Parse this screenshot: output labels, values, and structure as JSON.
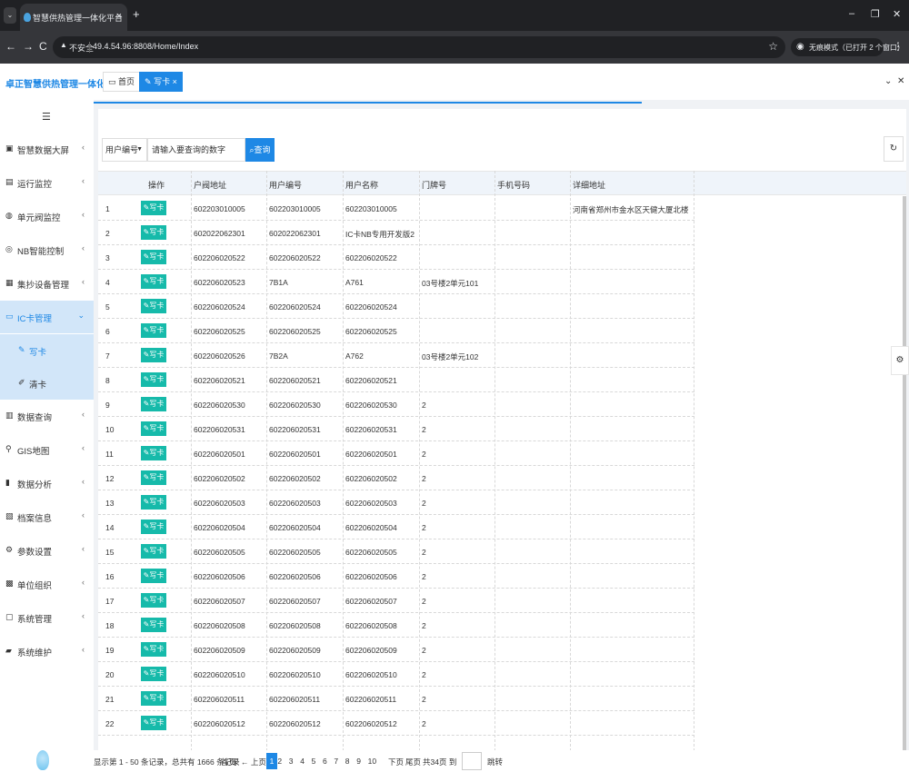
{
  "browser": {
    "tab_title": "智慧供热管理一体化平台",
    "tab_close": "×",
    "new_tab": "+",
    "minimize": "–",
    "maximize": "❐",
    "close": "✕",
    "back": "←",
    "forward": "→",
    "reload": "C",
    "insecure_label": "不安全",
    "url": "49.4.54.96:8808/Home/Index",
    "incognito_label": "无痕模式（已打开 2 个窗口）"
  },
  "header": {
    "brand": "卓正智慧供热管理一体化平台",
    "tabs": [
      {
        "icon": "home-icon",
        "label": "首页",
        "active": false
      },
      {
        "icon": "edit-icon",
        "label": "写卡 ×",
        "active": true
      }
    ],
    "chevron": "⌄",
    "close_all": "✕"
  },
  "sidebar": {
    "toggle": "☰",
    "items": [
      {
        "icon": "dashboard-icon",
        "label": "智慧数据大屏",
        "arrow": "‹"
      },
      {
        "icon": "monitor-icon",
        "label": "运行监控",
        "arrow": "‹"
      },
      {
        "icon": "unit-valve-icon",
        "label": "单元阀监控",
        "arrow": "‹"
      },
      {
        "icon": "nb-icon",
        "label": "NB智能控制",
        "arrow": "‹"
      },
      {
        "icon": "device-icon",
        "label": "集抄设备管理",
        "arrow": "‹"
      },
      {
        "icon": "card-icon",
        "label": "IC卡管理",
        "arrow": "⌄",
        "active": true
      },
      {
        "icon": "query-icon",
        "label": "数据查询",
        "arrow": "‹"
      },
      {
        "icon": "map-pin-icon",
        "label": "GIS地图",
        "arrow": "‹"
      },
      {
        "icon": "chart-icon",
        "label": "数据分析",
        "arrow": "‹"
      },
      {
        "icon": "archive-icon",
        "label": "档案信息",
        "arrow": "‹"
      },
      {
        "icon": "settings-icon",
        "label": "参数设置",
        "arrow": "‹"
      },
      {
        "icon": "org-icon",
        "label": "单位组织",
        "arrow": "‹"
      },
      {
        "icon": "system-icon",
        "label": "系统管理",
        "arrow": "‹"
      },
      {
        "icon": "maintenance-icon",
        "label": "系统维护",
        "arrow": "‹"
      }
    ],
    "subitems": [
      {
        "icon": "edit-icon",
        "label": "写卡",
        "active": true
      },
      {
        "icon": "eraser-icon",
        "label": "清卡",
        "active": false
      }
    ]
  },
  "filter": {
    "select_value": "用户编号",
    "keyword_placeholder": "请输入要查询的数字",
    "query_label": "查询",
    "refresh": "↻"
  },
  "table": {
    "columns": [
      "操作",
      "户阀地址",
      "用户编号",
      "用户名称",
      "门牌号",
      "手机号码",
      "详细地址"
    ],
    "action_label": "写卡",
    "rows": [
      [
        "1",
        "602203010005",
        "602203010005",
        "602203010005",
        "",
        "",
        "河南省郑州市金水区天健大厦北楼"
      ],
      [
        "2",
        "602022062301",
        "602022062301",
        "IC卡NB专用开发版2",
        "",
        "",
        ""
      ],
      [
        "3",
        "602206020522",
        "602206020522",
        "602206020522",
        "",
        "",
        ""
      ],
      [
        "4",
        "602206020523",
        "7B1A",
        "A761",
        "03号楼2单元101",
        "",
        ""
      ],
      [
        "5",
        "602206020524",
        "602206020524",
        "602206020524",
        "",
        "",
        ""
      ],
      [
        "6",
        "602206020525",
        "602206020525",
        "602206020525",
        "",
        "",
        ""
      ],
      [
        "7",
        "602206020526",
        "7B2A",
        "A762",
        "03号楼2单元102",
        "",
        ""
      ],
      [
        "8",
        "602206020521",
        "602206020521",
        "602206020521",
        "",
        "",
        ""
      ],
      [
        "9",
        "602206020530",
        "602206020530",
        "602206020530",
        "2",
        "",
        ""
      ],
      [
        "10",
        "602206020531",
        "602206020531",
        "602206020531",
        "2",
        "",
        ""
      ],
      [
        "11",
        "602206020501",
        "602206020501",
        "602206020501",
        "2",
        "",
        ""
      ],
      [
        "12",
        "602206020502",
        "602206020502",
        "602206020502",
        "2",
        "",
        ""
      ],
      [
        "13",
        "602206020503",
        "602206020503",
        "602206020503",
        "2",
        "",
        ""
      ],
      [
        "14",
        "602206020504",
        "602206020504",
        "602206020504",
        "2",
        "",
        ""
      ],
      [
        "15",
        "602206020505",
        "602206020505",
        "602206020505",
        "2",
        "",
        ""
      ],
      [
        "16",
        "602206020506",
        "602206020506",
        "602206020506",
        "2",
        "",
        ""
      ],
      [
        "17",
        "602206020507",
        "602206020507",
        "602206020507",
        "2",
        "",
        ""
      ],
      [
        "18",
        "602206020508",
        "602206020508",
        "602206020508",
        "2",
        "",
        ""
      ],
      [
        "19",
        "602206020509",
        "602206020509",
        "602206020509",
        "2",
        "",
        ""
      ],
      [
        "20",
        "602206020510",
        "602206020510",
        "602206020510",
        "2",
        "",
        ""
      ],
      [
        "21",
        "602206020511",
        "602206020511",
        "602206020511",
        "2",
        "",
        ""
      ],
      [
        "22",
        "602206020512",
        "602206020512",
        "602206020512",
        "2",
        "",
        ""
      ]
    ]
  },
  "pager": {
    "info": "显示第 1 - 50 条记录，总共有 1666 条记录",
    "first": "首页",
    "prev": "← 上页",
    "pages": [
      "1",
      "2",
      "3",
      "4",
      "5",
      "6",
      "7",
      "8",
      "9",
      "10"
    ],
    "current": "1",
    "next": "下页",
    "last": "尾页",
    "total_pages": "共34页 到",
    "jump": "跳转"
  },
  "colors": {
    "accent": "#1e88e5",
    "write_button": "#16baaa",
    "active_nav_bg": "#d2e6f9"
  }
}
